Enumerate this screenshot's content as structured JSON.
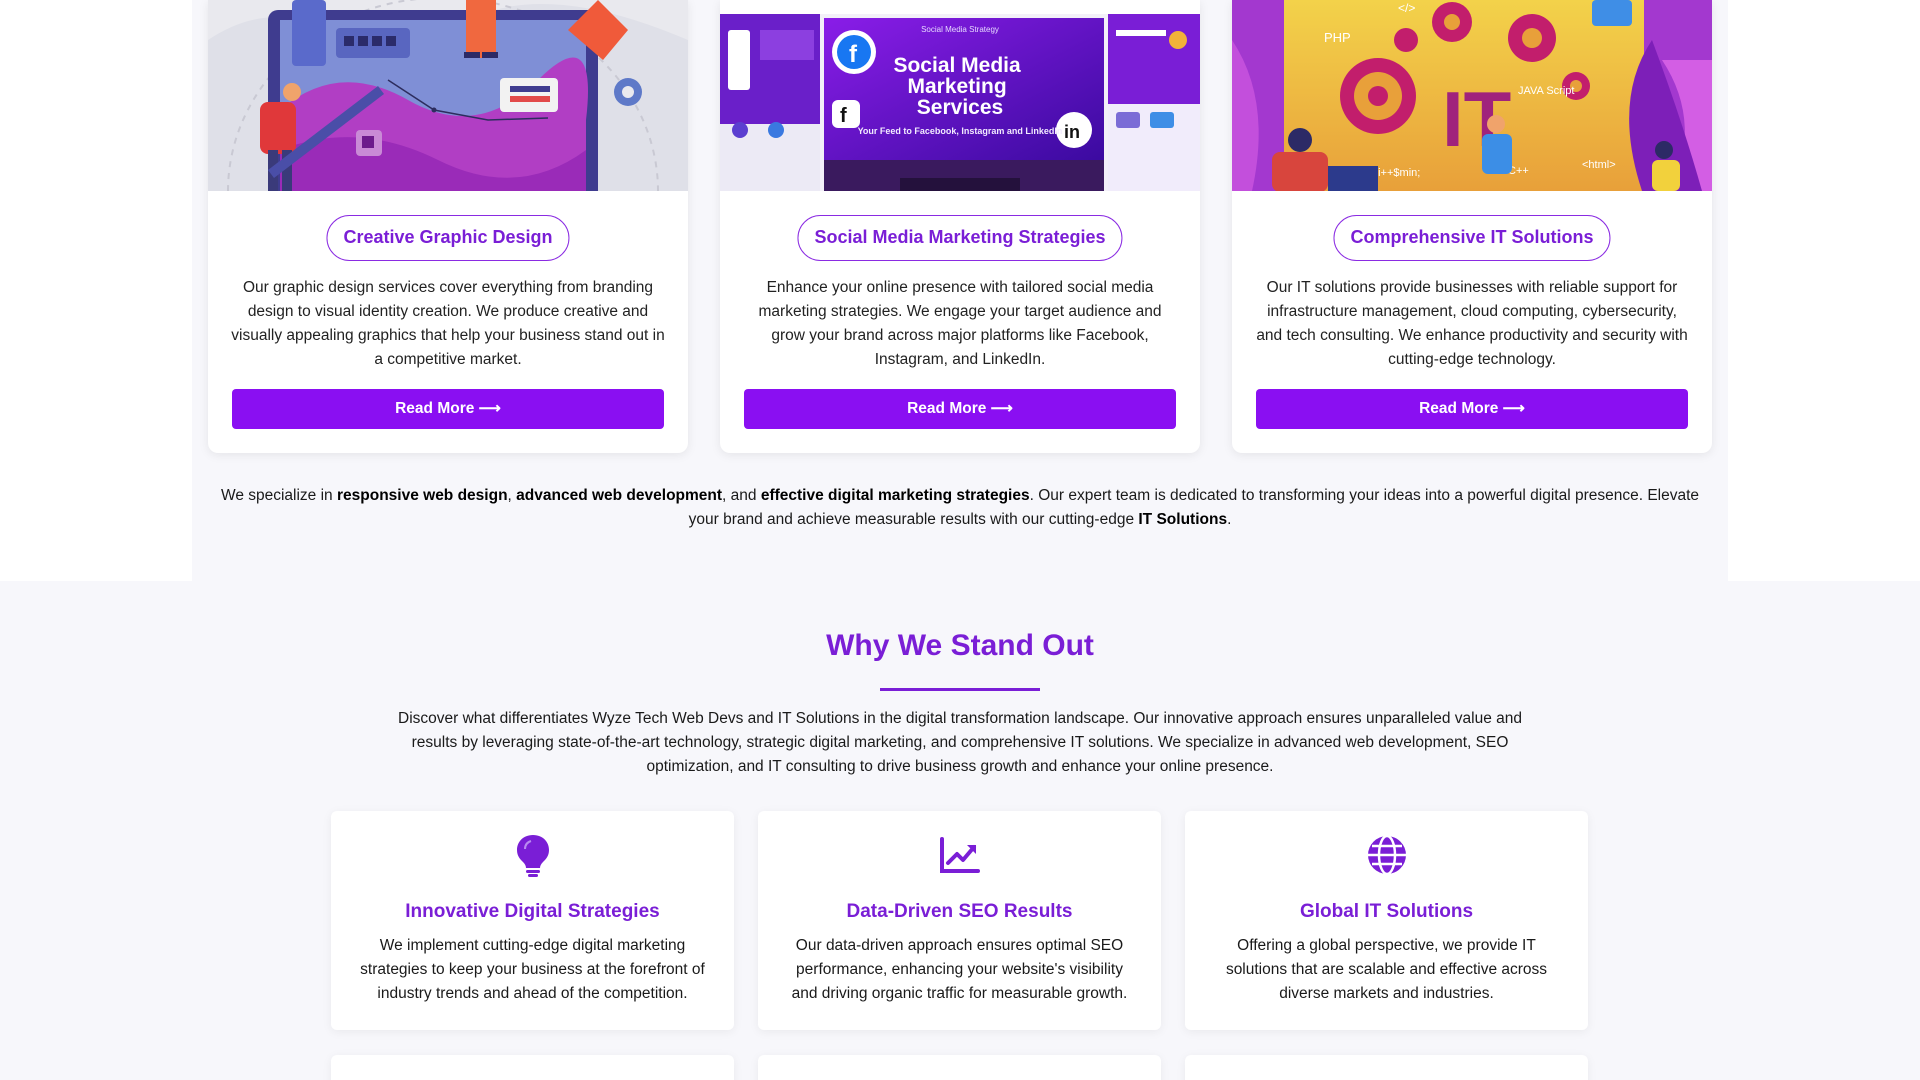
{
  "colors": {
    "accent": "#7a1ed6",
    "button": "#8a0ff2",
    "background": "#f7f7fb"
  },
  "services": [
    {
      "title": "Creative Graphic Design",
      "description": "Our graphic design services cover everything from branding design to visual identity creation. We produce creative and visually appealing graphics that help your business stand out in a competitive market.",
      "button": "Read More ⟶"
    },
    {
      "title": "Social Media Marketing Strategies",
      "description": "Enhance your online presence with tailored social media marketing strategies. We engage your target audience and grow your brand across major platforms like Facebook, Instagram, and LinkedIn.",
      "button": "Read More ⟶",
      "image_text": {
        "kicker": "Social Media Strategy",
        "headline": "Social Media Marketing Services",
        "sub": "Your Feed to Facebook, Instagram and LinkedIn"
      }
    },
    {
      "title": "Comprehensive IT Solutions",
      "description": "Our IT solutions provide businesses with reliable support for infrastructure management, cloud computing, cybersecurity, and tech consulting. We enhance productivity and security with cutting-edge technology.",
      "button": "Read More ⟶",
      "image_text": {
        "big": "IT",
        "php": "PHP",
        "java": "JAVA Script",
        "cpp": "C++",
        "html": "<html>",
        "code": "</>",
        "dollar": "$i++$min;"
      }
    }
  ],
  "summary": {
    "p1": "We specialize in ",
    "b1": "responsive web design",
    "p2": ", ",
    "b2": "advanced web development",
    "p3": ", and ",
    "b3": "effective digital marketing strategies",
    "p4": ". Our expert team is dedicated to transforming your ideas into a powerful digital presence. Elevate your brand and achieve measurable results with our cutting-edge ",
    "b4": "IT Solutions",
    "p5": "."
  },
  "why": {
    "title": "Why We Stand Out",
    "intro": "Discover what differentiates Wyze Tech Web Devs and IT Solutions in the digital transformation landscape. Our innovative approach ensures unparalleled value and results by leveraging state-of-the-art technology, strategic digital marketing, and comprehensive IT solutions. We specialize in advanced web development, SEO optimization, and IT consulting to drive business growth and enhance your online presence.",
    "features": [
      {
        "icon": "lightbulb-icon",
        "title": "Innovative Digital Strategies",
        "description": "We implement cutting-edge digital marketing strategies to keep your business at the forefront of industry trends and ahead of the competition."
      },
      {
        "icon": "chart-line-icon",
        "title": "Data-Driven SEO Results",
        "description": "Our data-driven approach ensures optimal SEO performance, enhancing your website's visibility and driving organic traffic for measurable growth."
      },
      {
        "icon": "globe-icon",
        "title": "Global IT Solutions",
        "description": "Offering a global perspective, we provide IT solutions that are scalable and effective across diverse markets and industries."
      }
    ]
  }
}
